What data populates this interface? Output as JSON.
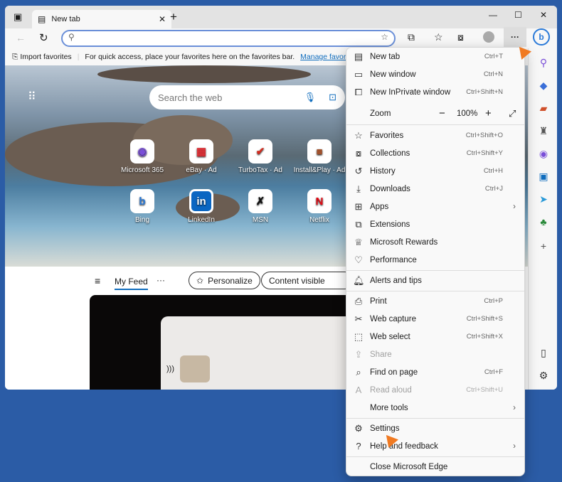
{
  "tab": {
    "title": "New tab"
  },
  "address": {
    "value": "",
    "placeholder": ""
  },
  "favorites_bar": {
    "import": "Import favorites",
    "message": "For quick access, place your favorites here on the favorites bar.",
    "manage": "Manage favorites now"
  },
  "hero": {
    "search_placeholder": "Search the web",
    "tiles": [
      {
        "label": "Microsoft 365",
        "ad": ""
      },
      {
        "label": "eBay",
        "ad": "· Ad"
      },
      {
        "label": "TurboTax",
        "ad": "· Ad"
      },
      {
        "label": "Install&Play",
        "ad": "· Ad"
      },
      {
        "label": "Bing",
        "ad": ""
      },
      {
        "label": "LinkedIn",
        "ad": ""
      },
      {
        "label": "MSN",
        "ad": ""
      },
      {
        "label": "Netflix",
        "ad": ""
      }
    ]
  },
  "feed": {
    "my_feed": "My Feed",
    "more": "···",
    "personalize": "Personalize",
    "content_visible": "Content visible"
  },
  "menu": {
    "items": [
      {
        "label": "New tab",
        "shortcut": "Ctrl+T",
        "icon": "new-tab-icon"
      },
      {
        "label": "New window",
        "shortcut": "Ctrl+N",
        "icon": "window-icon"
      },
      {
        "label": "New InPrivate window",
        "shortcut": "Ctrl+Shift+N",
        "icon": "inprivate-icon"
      },
      {
        "label": "Zoom",
        "zoom_value": "100%"
      },
      {
        "label": "Favorites",
        "shortcut": "Ctrl+Shift+O",
        "icon": "favorites-icon"
      },
      {
        "label": "Collections",
        "shortcut": "Ctrl+Shift+Y",
        "icon": "collections-icon"
      },
      {
        "label": "History",
        "shortcut": "Ctrl+H",
        "icon": "history-icon"
      },
      {
        "label": "Downloads",
        "shortcut": "Ctrl+J",
        "icon": "download-icon"
      },
      {
        "label": "Apps",
        "icon": "apps-icon"
      },
      {
        "label": "Extensions",
        "icon": "extensions-icon"
      },
      {
        "label": "Microsoft Rewards",
        "icon": "rewards-icon"
      },
      {
        "label": "Performance",
        "icon": "performance-icon"
      },
      {
        "label": "Alerts and tips",
        "icon": "bell-icon"
      },
      {
        "label": "Print",
        "shortcut": "Ctrl+P",
        "icon": "print-icon"
      },
      {
        "label": "Web capture",
        "shortcut": "Ctrl+Shift+S",
        "icon": "web-capture-icon"
      },
      {
        "label": "Web select",
        "shortcut": "Ctrl+Shift+X",
        "icon": "web-select-icon"
      },
      {
        "label": "Share",
        "icon": "share-icon",
        "disabled": true
      },
      {
        "label": "Find on page",
        "shortcut": "Ctrl+F",
        "icon": "find-icon"
      },
      {
        "label": "Read aloud",
        "shortcut": "Ctrl+Shift+U",
        "icon": "read-aloud-icon",
        "disabled": true
      },
      {
        "label": "More tools"
      },
      {
        "label": "Settings",
        "icon": "gear-icon"
      },
      {
        "label": "Help and feedback",
        "icon": "help-icon"
      },
      {
        "label": "Close Microsoft Edge"
      }
    ]
  },
  "colors": {
    "accent": "#0f6cbd",
    "arrow": "#f07a22",
    "desktop": "#2b5ca6"
  }
}
